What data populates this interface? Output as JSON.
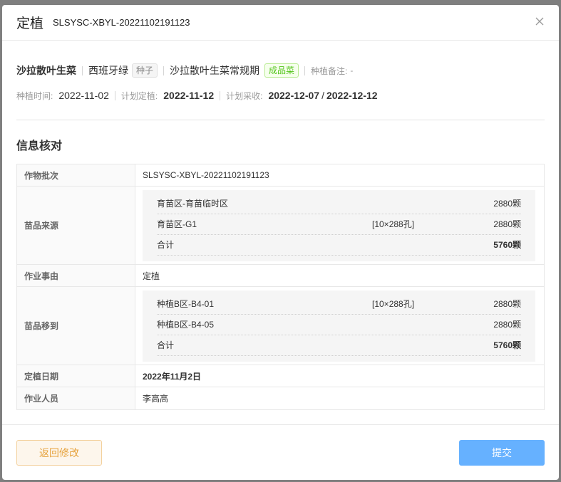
{
  "modal": {
    "title": "定植",
    "batch": "SLSYSC-XBYL-20221102191123"
  },
  "summary": {
    "crop": "沙拉散叶生菜",
    "variety": "西班牙绿",
    "seed_tag": "种子",
    "spec": "沙拉散叶生菜常规期",
    "product_tag": "成品菜",
    "note_label": "种植备注:",
    "note_value": "-",
    "plant_time_label": "种植时间:",
    "plant_time_value": "2022-11-02",
    "plan_transplant_label": "计划定植:",
    "plan_transplant_value": "2022-11-12",
    "plan_harvest_label": "计划采收:",
    "plan_harvest_start": "2022-12-07",
    "plan_harvest_sep": "/",
    "plan_harvest_end": "2022-12-12"
  },
  "section_title": "信息核对",
  "info": {
    "batch_label": "作物批次",
    "batch_value": "SLSYSC-XBYL-20221102191123",
    "source_label": "苗品来源",
    "source_rows": [
      {
        "name": "育苗区-育苗临时区",
        "spec": "",
        "qty": "2880颗"
      },
      {
        "name": "育苗区-G1",
        "spec": "[10×288孔]",
        "qty": "2880颗"
      }
    ],
    "source_total": {
      "name": "合计",
      "qty": "5760颗"
    },
    "reason_label": "作业事由",
    "reason_value": "定植",
    "target_label": "苗品移到",
    "target_rows": [
      {
        "name": "种植B区-B4-01",
        "spec": "[10×288孔]",
        "qty": "2880颗"
      },
      {
        "name": "种植B区-B4-05",
        "spec": "",
        "qty": "2880颗"
      }
    ],
    "target_total": {
      "name": "合计",
      "qty": "5760颗"
    },
    "date_label": "定植日期",
    "date_value": "2022年11月2日",
    "operator_label": "作业人员",
    "operator_value": "李高高"
  },
  "footer": {
    "back_label": "返回修改",
    "submit_label": "提交"
  },
  "colors": {
    "submit": "#66b1ff",
    "back_text": "#e6a23c",
    "product_tag": "#52c41a"
  }
}
